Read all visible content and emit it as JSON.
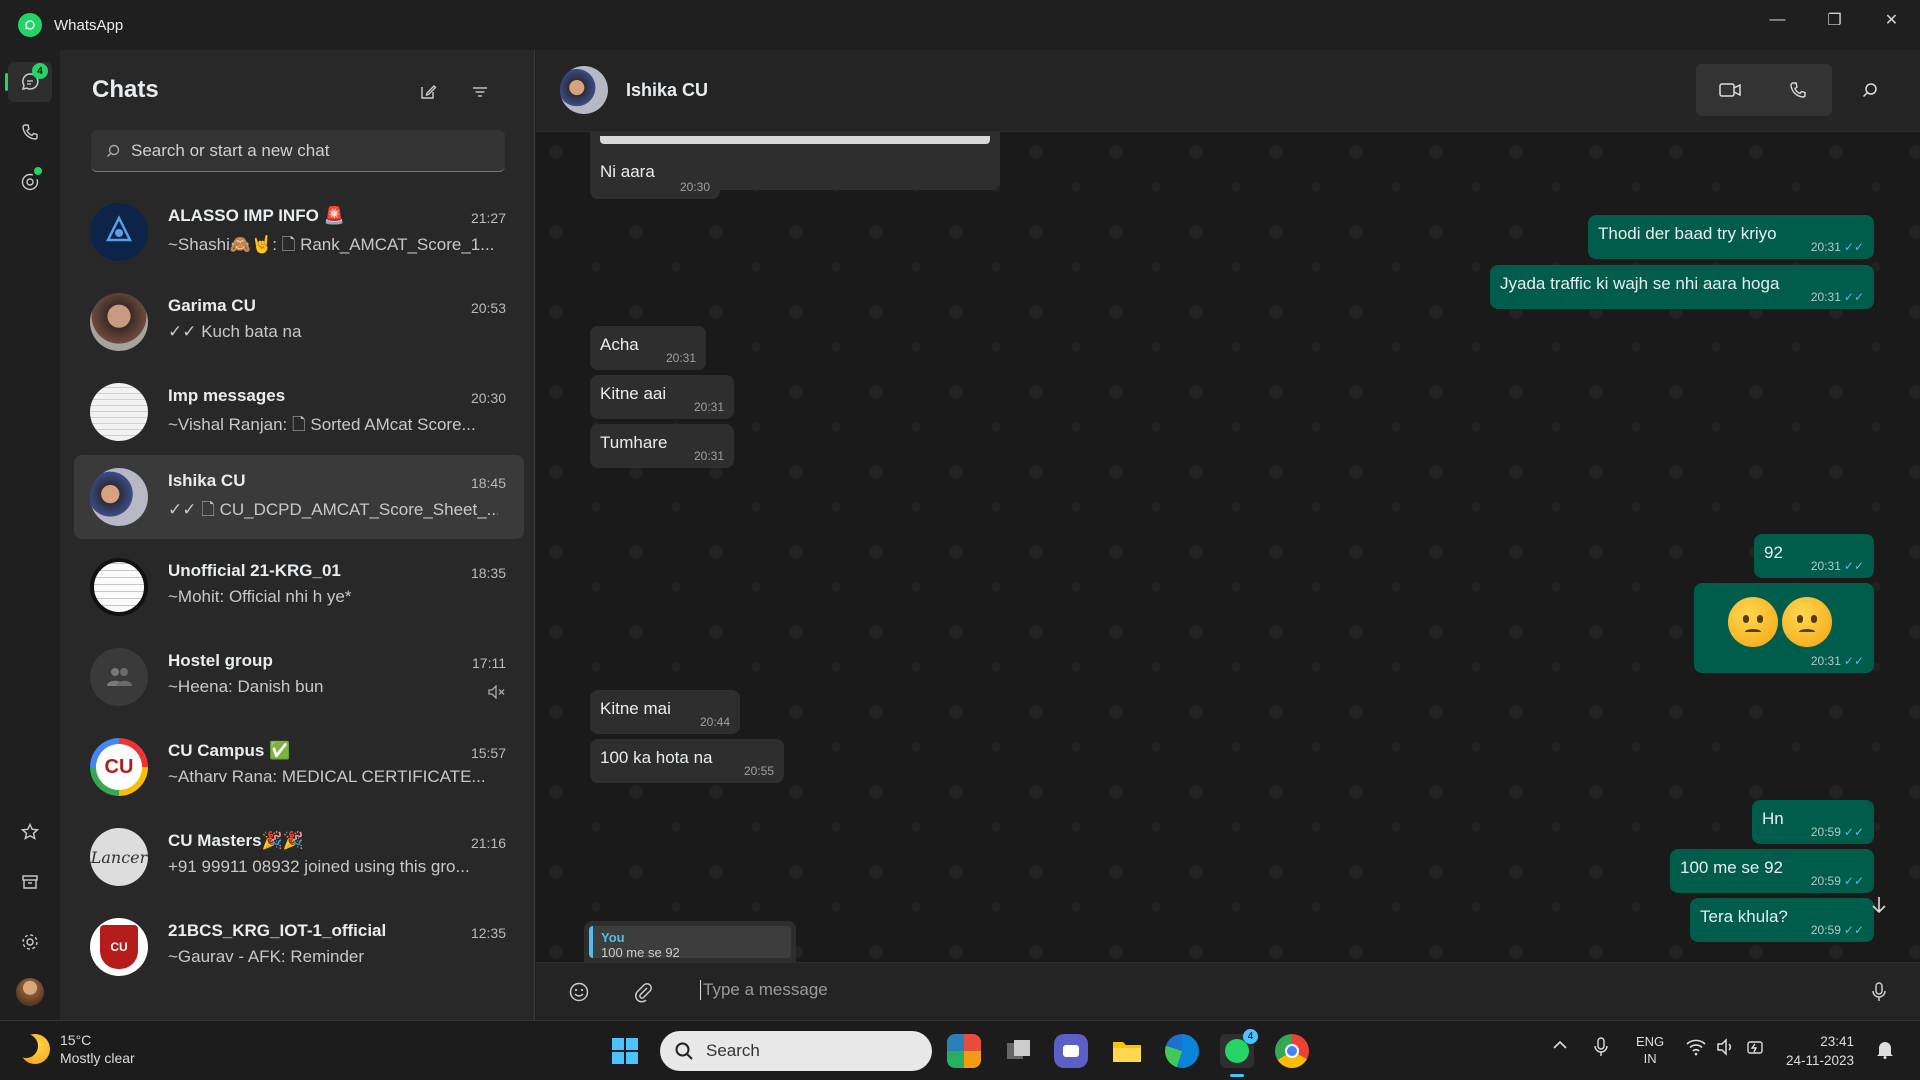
{
  "window": {
    "title": "WhatsApp",
    "minimize": "—",
    "maximize": "❐",
    "close": "✕"
  },
  "rail": {
    "chats_badge": "4"
  },
  "sidebar": {
    "header": "Chats",
    "search_placeholder": "Search or start a new chat",
    "chats": [
      {
        "name": "ALASSO IMP INFO 🚨",
        "time": "21:27",
        "preview": "~Shashi🙈🤘: 🗋 Rank_AMCAT_Score_1..."
      },
      {
        "name": "Garima CU",
        "time": "20:53",
        "preview": "✓✓ Kuch bata na"
      },
      {
        "name": "Imp messages",
        "time": "20:30",
        "preview": "~Vishal Ranjan: 🗋 Sorted AMcat Score..."
      },
      {
        "name": "Ishika CU",
        "time": "18:45",
        "preview": "✓✓ 🗋 CU_DCPD_AMCAT_Score_Sheet_..."
      },
      {
        "name": "Unofficial 21-KRG_01",
        "time": "18:35",
        "preview": "~Mohit: Official nhi h ye*"
      },
      {
        "name": "Hostel group",
        "time": "17:11",
        "preview": "~Heena: Danish bun"
      },
      {
        "name": "CU Campus ✅",
        "time": "15:57",
        "preview": "~Atharv Rana: MEDICAL CERTIFICATE..."
      },
      {
        "name": "CU Masters🎉🎉",
        "time": "21:16",
        "preview": "+91 99911 08932 joined using this gro..."
      },
      {
        "name": "21BCS_KRG_IOT-1_official",
        "time": "12:35",
        "preview": "~Gaurav - AFK: Reminder"
      }
    ]
  },
  "conversation": {
    "contact": "Ishika CU",
    "messages": [
      {
        "dir": "in",
        "text": "Ni aara",
        "time": "20:30"
      },
      {
        "dir": "out",
        "text": "Thodi der baad try kriyo",
        "time": "20:31"
      },
      {
        "dir": "out",
        "text": "Jyada traffic ki wajh se nhi aara hoga",
        "time": "20:31"
      },
      {
        "dir": "in",
        "text": "Acha",
        "time": "20:31"
      },
      {
        "dir": "in",
        "text": "Kitne aai",
        "time": "20:31"
      },
      {
        "dir": "in",
        "text": "Tumhare",
        "time": "20:31"
      },
      {
        "dir": "out",
        "text": "92",
        "time": "20:31"
      },
      {
        "dir": "out",
        "text": "🙃🙃",
        "time": "20:31"
      },
      {
        "dir": "in",
        "text": "Kitne mai",
        "time": "20:44"
      },
      {
        "dir": "in",
        "text": "100 ka hota na",
        "time": "20:55"
      },
      {
        "dir": "out",
        "text": "Hn",
        "time": "20:59"
      },
      {
        "dir": "out",
        "text": "100 me se 92",
        "time": "20:59"
      },
      {
        "dir": "out",
        "text": "Tera khula?",
        "time": "20:59"
      }
    ],
    "quote": {
      "author": "You",
      "text": "100 me se 92"
    },
    "composer_placeholder": "Type a message"
  },
  "taskbar": {
    "weather_temp": "15°C",
    "weather_desc": "Mostly clear",
    "search": "Search",
    "whatsapp_badge": "4",
    "lang1": "ENG",
    "lang2": "IN",
    "time": "23:41",
    "date": "24-11-2023"
  },
  "colors": {
    "accent": "#25d366",
    "outgoing_bubble": "#005c4b",
    "incoming_bubble": "#2e2e2e",
    "read_tick": "#53bdeb"
  }
}
